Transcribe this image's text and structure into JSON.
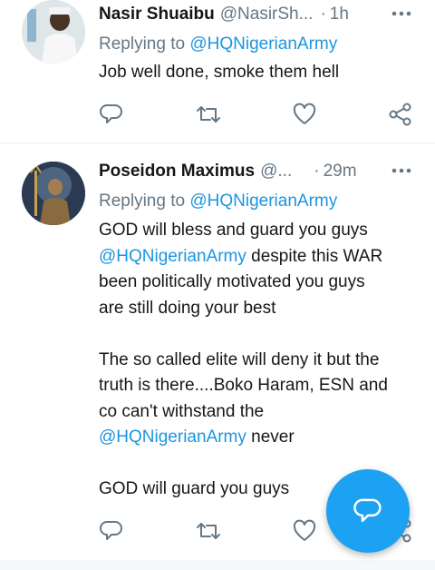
{
  "tweets": [
    {
      "name": "Nasir Shuaibu",
      "handle": "@NasirSh...",
      "separator": "·",
      "time": "1h",
      "replying_prefix": "Replying to",
      "replying_to": "@HQNigerianArmy",
      "text": "Job well done, smoke them hell"
    },
    {
      "name": "Poseidon Maximus",
      "handle": "@...",
      "separator": "·",
      "time": "29m",
      "replying_prefix": "Replying to",
      "replying_to": "@HQNigerianArmy",
      "p1_line1": "GOD will bless and guard you guys",
      "p1_mention": "@HQNigerianArmy",
      "p1_rest1": " despite this WAR",
      "p1_line3": "been politically motivated you guys",
      "p1_line4": "are still doing your best",
      "p2_line1": "The so called elite will deny it but the",
      "p2_line2": "truth is there....Boko Haram, ESN and",
      "p2_line3": "co can't withstand the",
      "p2_mention": "@HQNigerianArmy",
      "p2_rest": " never",
      "p3_line1": "GOD will guard you guys"
    }
  ],
  "icons": {
    "reply": "reply-icon",
    "retweet": "retweet-icon",
    "like": "like-icon",
    "share": "share-icon",
    "more": "more-icon",
    "compose": "compose-reply-icon"
  },
  "colors": {
    "link": "#1b95e0",
    "secondary": "#657786",
    "fab": "#1da1f2"
  }
}
